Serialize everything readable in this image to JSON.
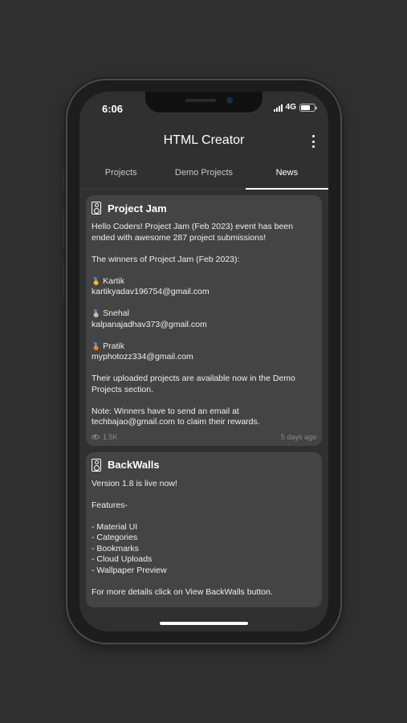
{
  "status": {
    "time": "6:06",
    "network": "4G",
    "battery_level": 0.7
  },
  "app": {
    "title": "HTML Creator"
  },
  "tabs": [
    {
      "label": "Projects",
      "active": false
    },
    {
      "label": "Demo Projects",
      "active": false
    },
    {
      "label": "News",
      "active": true
    }
  ],
  "news": [
    {
      "title": "Project Jam",
      "intro": "Hello Coders! Project Jam (Feb 2023) event has been ended with awesome 287 project submissions!",
      "winners_heading": "The winners of Project Jam (Feb 2023):",
      "winners": [
        {
          "medal": "🥇",
          "name": "Kartik",
          "email": "kartikyadav196754@gmail.com"
        },
        {
          "medal": "🥈",
          "name": "Snehal",
          "email": "kalpanajadhav373@gmail.com"
        },
        {
          "medal": "🥉",
          "name": "Pratik",
          "email": "myphotozz334@gmail.com"
        }
      ],
      "availability": "Their uploaded projects are available now in the Demo Projects section.",
      "note": "Note: Winners have to send an email at techbajao@gmail.com to claim their rewards.",
      "views": "1.5K",
      "posted": "5 days ago"
    },
    {
      "title": "BackWalls",
      "intro": "Version 1.8 is live now!",
      "features_heading": "Features-",
      "features": [
        "- Material UI",
        "- Categories",
        "- Bookmarks",
        "- Cloud Uploads",
        "- Wallpaper Preview"
      ],
      "more": "For more details click on View BackWalls button."
    }
  ]
}
